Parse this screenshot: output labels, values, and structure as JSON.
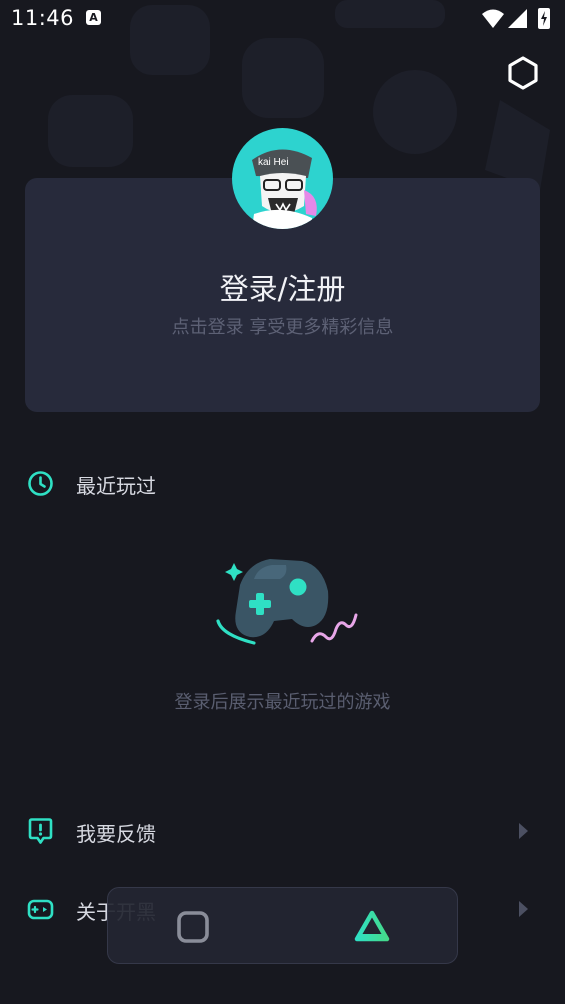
{
  "status_bar": {
    "time": "11:46",
    "notification_icon": "a-box-icon",
    "icons": [
      "wifi-icon",
      "signal-icon",
      "battery-charging-icon"
    ]
  },
  "header": {
    "settings_icon": "hexagon-icon"
  },
  "profile": {
    "title": "登录/注册",
    "subtitle": "点击登录 享受更多精彩信息",
    "avatar_text": "kai Hei"
  },
  "recent": {
    "label": "最近玩过",
    "icon": "clock-icon",
    "empty_text": "登录后展示最近玩过的游戏"
  },
  "menu": [
    {
      "label": "我要反馈",
      "icon": "feedback-icon"
    },
    {
      "label": "关于开黑",
      "icon": "gamepad-icon"
    }
  ],
  "navbar": {
    "items": [
      "square-icon",
      "triangle-icon"
    ]
  },
  "colors": {
    "accent": "#2fe0c4",
    "background": "#17181f",
    "card": "#272a3b",
    "pink": "#e8a6e8"
  }
}
